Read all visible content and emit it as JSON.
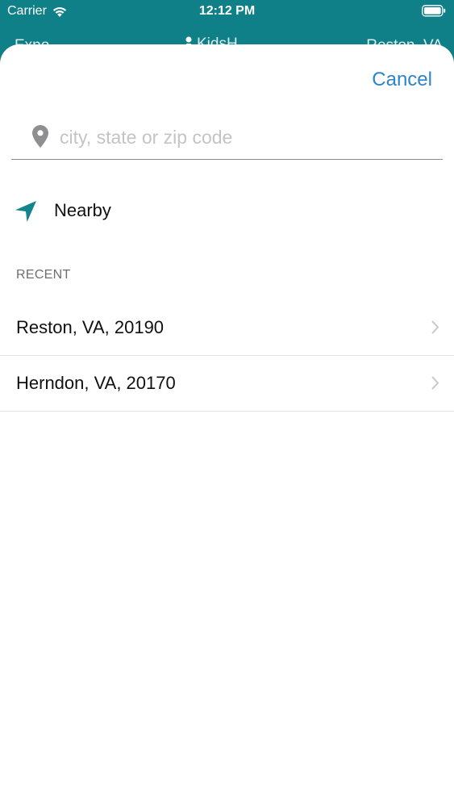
{
  "status_bar": {
    "carrier": "Carrier",
    "time": "12:12 PM",
    "icons": [
      "wifi-icon",
      "battery-icon"
    ]
  },
  "background_header": {
    "left": "Expo",
    "center": "KidsH",
    "right": "Reston, VA"
  },
  "sheet": {
    "cancel_label": "Cancel",
    "search": {
      "placeholder": "city, state or zip code",
      "value": "",
      "icon": "map-pin-icon"
    },
    "nearby": {
      "label": "Nearby",
      "icon": "location-arrow-icon"
    },
    "recent_header": "RECENT",
    "recent_items": [
      {
        "label": "Reston, VA, 20190"
      },
      {
        "label": "Herndon, VA, 20170"
      }
    ]
  },
  "colors": {
    "brand_teal": "#0f8088",
    "accent_blue": "#2a86c9",
    "icon_teal": "#12858e",
    "pin_gray": "#8e8e93"
  }
}
